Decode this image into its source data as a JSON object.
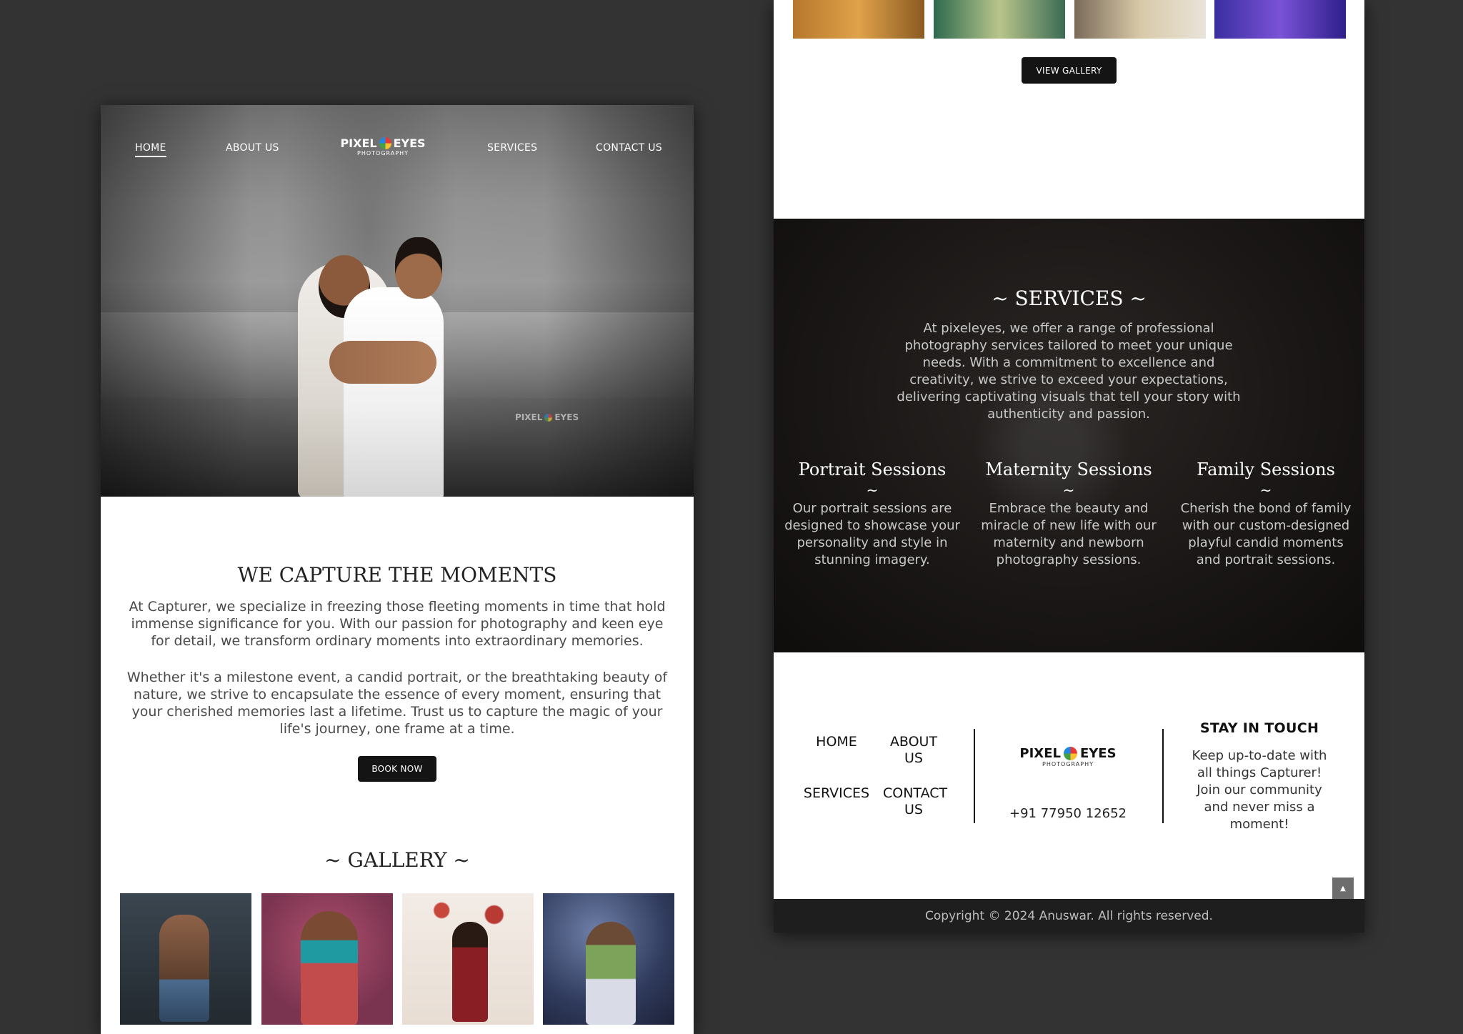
{
  "left": {
    "nav": {
      "home": "HOME",
      "about": "ABOUT US",
      "services": "SERVICES",
      "contact": "CONTACT US"
    },
    "logo": {
      "pixel": "PIXEL",
      "eyes": "EYES",
      "sub": "PHOTOGRAPHY"
    },
    "watermark": {
      "pixel": "PIXEL",
      "eyes": "EYES"
    },
    "intro": {
      "title": "WE CAPTURE THE MOMENTS",
      "para1": "At Capturer, we specialize in freezing those fleeting moments in time that hold immense significance for you. With our passion for photography and keen eye for detail, we transform ordinary moments into extraordinary memories.",
      "para2": "Whether it's a milestone event, a candid portrait, or the breathtaking beauty of nature, we strive to encapsulate the essence of every moment, ensuring that your cherished memories last a lifetime. Trust us to capture the magic of your life's journey, one frame at a time.",
      "book_button": "BOOK NOW"
    },
    "gallery": {
      "title": "~ GALLERY ~",
      "images": [
        "gym-portrait",
        "traditional-saree-portrait",
        "beach-floral-arch-portrait",
        "fairy-lights-portrait"
      ]
    }
  },
  "right": {
    "gallery_button": "VIEW GALLERY",
    "services": {
      "title": "~ SERVICES ~",
      "description": "At pixeleyes, we offer a range of professional photography services tailored to meet your unique needs. With a commitment to excellence and creativity, we strive to exceed your expectations, delivering captivating visuals that tell your story with authenticity and passion.",
      "items": [
        {
          "title": "Portrait Sessions",
          "tilde": "~",
          "text": "Our portrait sessions are designed to showcase your personality and style in stunning imagery."
        },
        {
          "title": "Maternity Sessions",
          "tilde": "~",
          "text": "Embrace the beauty and miracle of new life with our maternity and newborn photography sessions."
        },
        {
          "title": "Family Sessions",
          "tilde": "~",
          "text": "Cherish the bond of family with our custom-designed playful candid moments and portrait sessions."
        }
      ]
    },
    "footer": {
      "links": {
        "home": "HOME",
        "about": "ABOUT US",
        "services": "SERVICES",
        "contact": "CONTACT US"
      },
      "logo": {
        "pixel": "PIXEL",
        "eyes": "EYES",
        "sub": "PHOTOGRAPHY"
      },
      "phone": "+91 77950 12652",
      "stay_title": "STAY IN TOUCH",
      "stay_text": "Keep up-to-date with all things Capturer! Join our community and never miss a moment!",
      "copyright": "Copyright © 2024 Anuswar. All rights reserved.",
      "scroll_top_icon": "caret-up-icon"
    }
  },
  "colors": {
    "background": "#333333",
    "dark_button": "#141414",
    "services_band": "#1a1716",
    "copyright_bar": "#1e1e1e"
  }
}
